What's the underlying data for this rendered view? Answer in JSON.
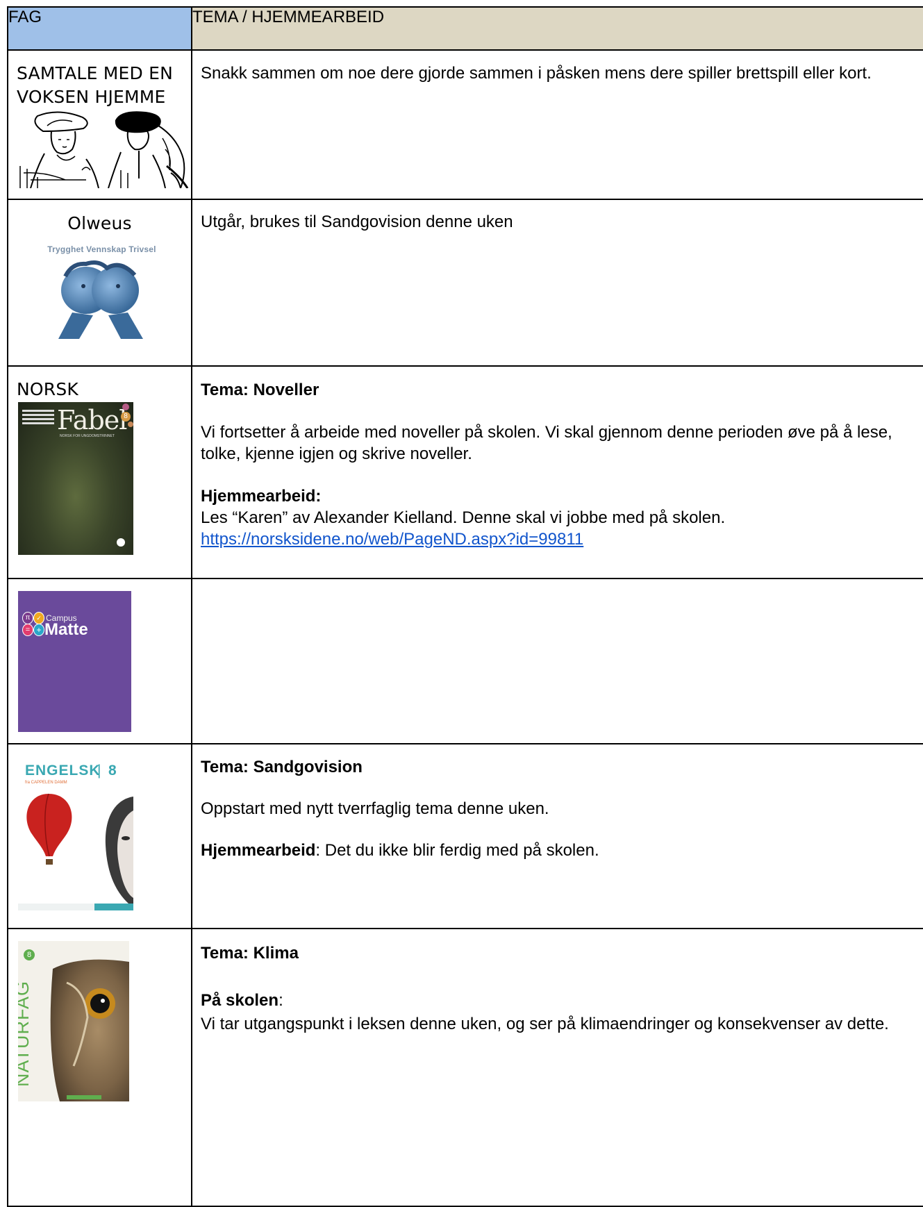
{
  "header": {
    "col1": "FAG",
    "col2": "TEMA / HJEMMEARBEID"
  },
  "rows": [
    {
      "subject": "SAMTALE MED EN VOKSEN HJEMME",
      "image": "two-ladies-drawing",
      "text": "Snakk sammen om noe dere gjorde sammen i påsken mens dere spiller brettspill eller kort."
    },
    {
      "subject": "Olweus",
      "image_caption": "Trygghet Vennskap Trivsel",
      "text": "Utgår, brukes til Sandgovision denne uken"
    },
    {
      "subject": "NORSK",
      "book_title": "Fabel",
      "book_level": "8",
      "book_subtitle": "NORSK FOR UNGDOMSTRINNET",
      "theme": "Tema: Noveller",
      "paragraph": "Vi fortsetter å arbeide med noveller på skolen. Vi skal gjennom denne perioden øve på å lese, tolke, kjenne igjen og skrive noveller.",
      "homework_label": "Hjemmearbeid:",
      "homework_text": "Les “Karen” av Alexander Kielland. Denne skal vi jobbe med på skolen.",
      "link": "https://norsksidene.no/web/PageND.aspx?id=99811"
    },
    {
      "book_small": "Campus",
      "book_big": "Matte"
    },
    {
      "book_title": "ENGELSK",
      "book_level": "8",
      "book_publisher": "fra CAPPELEN DAMM",
      "theme": "Tema: Sandgovision",
      "paragraph": "Oppstart med nytt tverrfaglig tema denne uken.",
      "homework_label": "Hjemmearbeid",
      "homework_text": ": Det du ikke blir ferdig med på skolen."
    },
    {
      "book_title": "NATURFAG",
      "book_level": "8",
      "theme": "Tema: Klima",
      "school_label": "På skolen",
      "school_colon": ":",
      "paragraph": "Vi tar utgangspunkt i leksen denne uken, og ser på klimaendringer og konsekvenser av dette."
    }
  ],
  "colors": {
    "header_fag": "#9fc0e8",
    "header_tema": "#ddd7c3",
    "link": "#1155cc",
    "matte_bg": "#6a4a9b"
  }
}
